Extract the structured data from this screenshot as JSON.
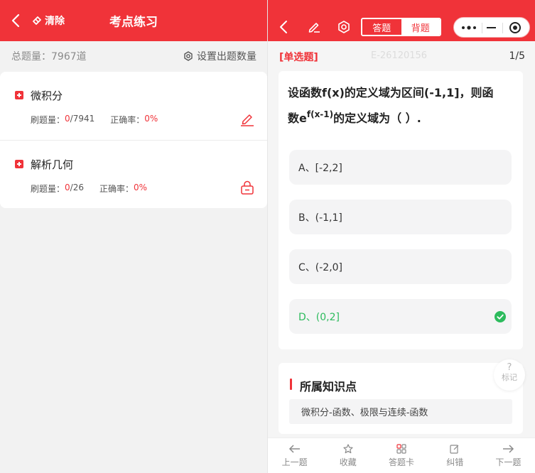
{
  "left": {
    "header": {
      "clear_label": "清除",
      "title": "考点练习"
    },
    "total_label": "总题量：7967道",
    "set_count_label": "设置出题数量",
    "items": [
      {
        "name": "微积分",
        "done_label": "刷题量：",
        "done": "0",
        "total": "/7941",
        "acc_label": "正确率：",
        "acc": "0%",
        "action_icon": "pencil-icon"
      },
      {
        "name": "解析几何",
        "done_label": "刷题量：",
        "done": "0",
        "total": "/26",
        "acc_label": "正确率：",
        "acc": "0%",
        "action_icon": "lock-icon"
      }
    ]
  },
  "right": {
    "header": {
      "modes": [
        "答题",
        "背题"
      ],
      "active_mode": "背题"
    },
    "question": {
      "type": "[单选题]",
      "code": "E-26120156",
      "page": "1/5",
      "text_line1": "设函数f(x)的定义域为区间(-1,1]，则函",
      "text_line2_prefix": "数e",
      "text_line2_sup": "f(x-1)",
      "text_line2_suffix": "的定义域为（  ）."
    },
    "options": [
      {
        "label": "A、[-2,2]",
        "correct": false
      },
      {
        "label": "B、(-1,1]",
        "correct": false
      },
      {
        "label": "C、(-2,0]",
        "correct": false
      },
      {
        "label": "D、(0,2]",
        "correct": true
      }
    ],
    "mark": {
      "icon": "?",
      "label": "标记"
    },
    "knowledge": {
      "title": "所属知识点",
      "tag": "微积分-函数、极限与连续-函数"
    },
    "bottom_nav": [
      {
        "label": "上一题",
        "icon": "arrow-left-icon"
      },
      {
        "label": "收藏",
        "icon": "star-icon"
      },
      {
        "label": "答题卡",
        "icon": "grid-icon"
      },
      {
        "label": "纠错",
        "icon": "edit-icon"
      },
      {
        "label": "下一题",
        "icon": "arrow-right-icon"
      }
    ]
  },
  "colors": {
    "brand": "#f03339",
    "correct": "#2dbb5d"
  }
}
